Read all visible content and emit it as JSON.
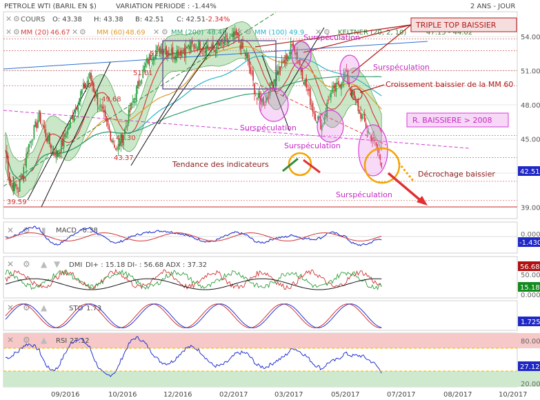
{
  "header": {
    "instrument": "PETROLE WTI (BARIL EN $)",
    "variation": "VARIATION PERIODE : -1.44%",
    "period": "2 ANS - JOUR"
  },
  "legend": {
    "cours": "COURS",
    "open": "O: 43.38",
    "high": "H: 43.38",
    "low": "B: 42.51",
    "close": "C: 42.51",
    "change": "-2.34%",
    "mm20": "MM (20)",
    "mm20_value": "46.67",
    "mm60": "MM (60)",
    "mm60_value": "48.69",
    "mm200": "MM (200)",
    "mm200_value": "48.48",
    "mm100": "MM (100)",
    "mm100_value": "49.9",
    "keltner": "KELTNER (20, 2, 10)",
    "keltner_values": "47.15 - 44.02"
  },
  "annotations": {
    "triple_top": "TRIPLE TOP BAISSIER",
    "surspeculation": "Surspéculation",
    "croisement": "Croissement baissier de la MM 60",
    "r_baissiere": "R. BAISSIERE > 2008",
    "tendance": "Tendance des indicateurs",
    "decrochage": "Décrochage baissier"
  },
  "level_labels": [
    "39.59",
    "41.28",
    "43.37",
    "45.30",
    "49.68",
    "49",
    "51.01",
    "52.76"
  ],
  "last_price": "42.51",
  "indicators": {
    "macd": {
      "label": "MACD",
      "value_text": "-0.38",
      "axis_top": "0.000",
      "badge": "-1.430"
    },
    "dmi": {
      "label": "DMI",
      "value_text": "DI+ : 15.18 DI- : 56.68 ADX : 37.32",
      "badge1": "56.68",
      "badge2": "15.18",
      "axis_top": "50.00",
      "axis_bottom": "0.000"
    },
    "sto": {
      "label": "STO",
      "value_text": "1.73",
      "badge": "1.725"
    },
    "rsi": {
      "label": "RSI",
      "value_text": "27.12",
      "axis_top": "80.00",
      "axis_bottom": "20.00",
      "badge": "27.12"
    }
  },
  "x_labels": [
    "09/2016",
    "10/2016",
    "12/2016",
    "02/2017",
    "03/2017",
    "05/2017",
    "07/2017",
    "08/2017",
    "10/2017"
  ],
  "colors": {
    "candle_up": "#1f9d3a",
    "candle_down": "#d32b2b",
    "keltner_fill": "#9fd59b",
    "mm20": "#d83c3c",
    "mm60": "#e09a2a",
    "mm200": "#2e9e6e",
    "mm100": "#2ab4c8",
    "surspec": "#d63ad6",
    "annotation_red": "#b01818",
    "badge_blue": "#1f28c4",
    "badge_red": "#b01010",
    "badge_green": "#138a1e",
    "rsi_upper_zone": "#f6c8c8",
    "rsi_lower_zone": "#cfe9cf"
  },
  "chart_data": {
    "type": "candlestick",
    "y_ticks": [
      39,
      42,
      45,
      48,
      51,
      54
    ],
    "ylim": [
      38.3,
      56.0
    ],
    "x_ticks": [
      "09/2016",
      "10/2016",
      "12/2016",
      "02/2017",
      "03/2017",
      "05/2017",
      "07/2017",
      "08/2017",
      "10/2017"
    ],
    "price_close_anchors": [
      [
        0,
        44.0
      ],
      [
        4,
        41.0
      ],
      [
        10,
        40.6
      ],
      [
        18,
        44.5
      ],
      [
        26,
        47.0
      ],
      [
        33,
        44.8
      ],
      [
        40,
        43.6
      ],
      [
        48,
        45.8
      ],
      [
        58,
        49.0
      ],
      [
        65,
        50.5
      ],
      [
        72,
        48.0
      ],
      [
        80,
        45.7
      ],
      [
        86,
        44.0
      ],
      [
        92,
        45.8
      ],
      [
        100,
        49.0
      ],
      [
        108,
        51.5
      ],
      [
        114,
        52.7
      ],
      [
        122,
        53.0
      ],
      [
        130,
        52.5
      ],
      [
        140,
        53.0
      ],
      [
        150,
        53.3
      ],
      [
        160,
        52.8
      ],
      [
        168,
        53.4
      ],
      [
        178,
        54.0
      ],
      [
        186,
        52.2
      ],
      [
        194,
        48.5
      ],
      [
        200,
        48.3
      ],
      [
        208,
        50.6
      ],
      [
        216,
        52.0
      ],
      [
        222,
        53.4
      ],
      [
        230,
        50.3
      ],
      [
        238,
        47.3
      ],
      [
        244,
        46.2
      ],
      [
        250,
        48.8
      ],
      [
        256,
        49.6
      ],
      [
        262,
        50.8
      ],
      [
        268,
        48.7
      ],
      [
        274,
        47.2
      ],
      [
        280,
        45.6
      ],
      [
        286,
        44.4
      ],
      [
        290,
        42.9
      ]
    ],
    "last_close": 42.51,
    "rsi_last": 27.12,
    "sto_last": 1.725,
    "macd_last": -1.43,
    "dmi": {
      "di_plus": 15.18,
      "di_minus": 56.68,
      "adx": 37.32
    }
  }
}
